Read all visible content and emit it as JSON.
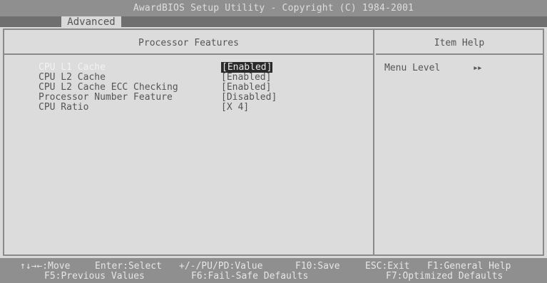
{
  "header": {
    "title": "AwardBIOS Setup Utility - Copyright (C) 1984-2001",
    "active_tab": "Advanced"
  },
  "left_panel": {
    "title": "Processor Features",
    "items": [
      {
        "label": "CPU L1 Cache",
        "value": "[Enabled]",
        "selected": true
      },
      {
        "label": "CPU L2 Cache",
        "value": "[Enabled]"
      },
      {
        "label": "CPU L2 Cache ECC Checking",
        "value": "[Enabled]"
      },
      {
        "label": "Processor Number Feature",
        "value": "[Disabled]"
      },
      {
        "label": "CPU Ratio",
        "value": "[X 4]"
      }
    ]
  },
  "right_panel": {
    "title": "Item Help",
    "menu_level_label": "Menu Level",
    "menu_level_arrow": "▸▸"
  },
  "footer": {
    "row1": {
      "move": "↑↓→←:Move",
      "select": "Enter:Select",
      "value": "+/-/PU/PD:Value",
      "save": "F10:Save",
      "exit": "ESC:Exit",
      "help": "F1:General Help"
    },
    "row2": {
      "previous": "F5:Previous Values",
      "failsafe": "F6:Fail-Safe Defaults",
      "optimized": "F7:Optimized Defaults"
    }
  },
  "colors": {
    "background": "#d9d9d9",
    "bar": "#8f8f8f",
    "highlight": "#2a2a2a"
  }
}
